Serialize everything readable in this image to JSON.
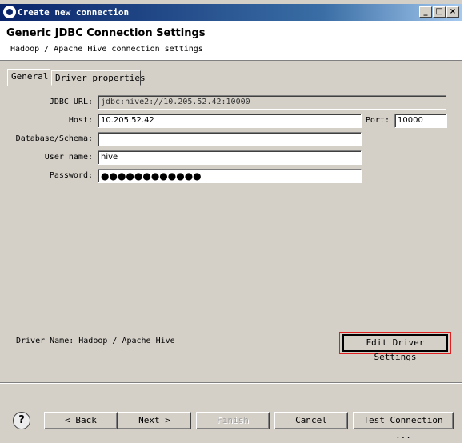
{
  "window": {
    "title": "Create new connection"
  },
  "header": {
    "title": "Generic JDBC Connection Settings",
    "subtitle": "Hadoop / Apache Hive connection settings"
  },
  "tabs": [
    {
      "label": "General",
      "active": true
    },
    {
      "label": "Driver properties",
      "active": false
    }
  ],
  "form": {
    "jdbc_url_label": "JDBC URL:",
    "jdbc_url": "jdbc:hive2://10.205.52.42:10000",
    "host_label": "Host:",
    "host": "10.205.52.42",
    "port_label": "Port:",
    "port": "10000",
    "database_label": "Database/Schema:",
    "database": "",
    "username_label": "User name:",
    "username": "hive",
    "password_label": "Password:",
    "password_masked": "●●●●●●●●●●●●"
  },
  "driver": {
    "name_label": "Driver Name: Hadoop / Apache Hive",
    "edit_button": "Edit Driver Settings"
  },
  "footer": {
    "help": "?",
    "back": "< Back",
    "next": "Next >",
    "finish": "Finish",
    "cancel": "Cancel",
    "test": "Test Connection ..."
  },
  "colors": {
    "highlight_border": "#e02020",
    "titlebar": "#0a246a"
  },
  "icons": [
    "app-icon",
    "minimize-icon",
    "maximize-icon",
    "close-icon",
    "help-icon"
  ]
}
